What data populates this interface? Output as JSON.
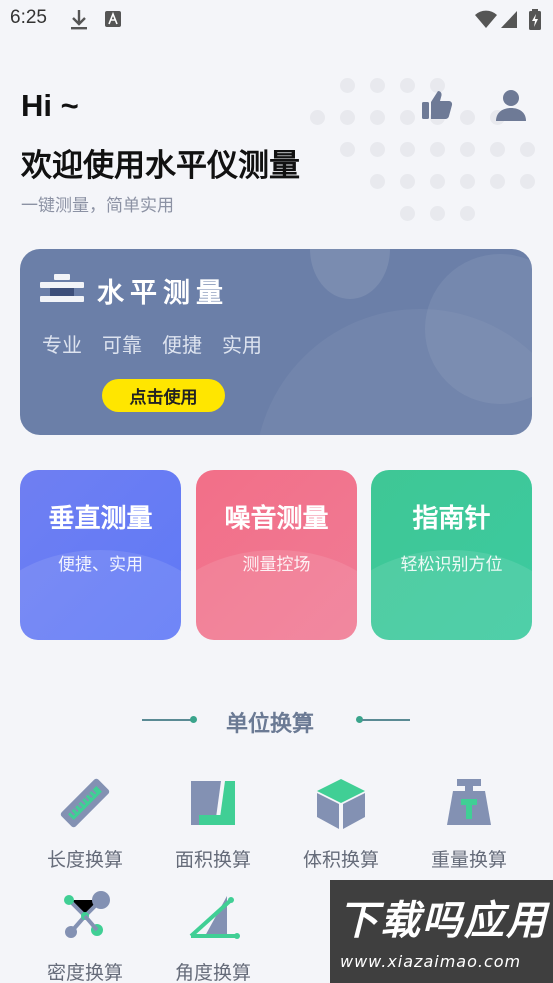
{
  "status_bar": {
    "time": "6:25"
  },
  "header": {
    "greeting": "Hi ~",
    "welcome": "欢迎使用水平仪测量",
    "subtitle": "一键测量，简单实用"
  },
  "main_card": {
    "title": "水平测量",
    "tags": [
      "专业",
      "可靠",
      "便捷",
      "实用"
    ],
    "button": "点击使用",
    "button_color": "#ffe600",
    "background": "#6b7fa8"
  },
  "features": [
    {
      "title": "垂直测量",
      "subtitle": "便捷、实用",
      "color": "#6779f4"
    },
    {
      "title": "噪音测量",
      "subtitle": "测量控场",
      "color": "#f07289"
    },
    {
      "title": "指南针",
      "subtitle": "轻松识别方位",
      "color": "#3fc799"
    }
  ],
  "section": {
    "title": "单位换算"
  },
  "tools": [
    {
      "label": "长度换算",
      "icon": "ruler-icon"
    },
    {
      "label": "面积换算",
      "icon": "area-icon"
    },
    {
      "label": "体积换算",
      "icon": "cube-icon"
    },
    {
      "label": "重量换算",
      "icon": "weight-icon"
    },
    {
      "label": "密度换算",
      "icon": "density-icon"
    },
    {
      "label": "角度换算",
      "icon": "angle-icon"
    }
  ],
  "watermark": {
    "main": "下载吗应用",
    "url": "www.xiazaimao.com"
  }
}
